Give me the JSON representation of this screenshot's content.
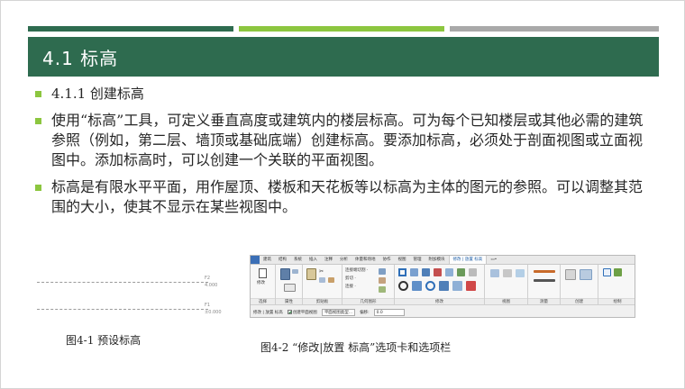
{
  "theme": {
    "accent_dark": "#2e6b4f",
    "accent_light": "#8cc63f",
    "accent_gray": "#a9a9a9",
    "title_band": "#2e6b4f",
    "bullet": "#8cc63f"
  },
  "slide": {
    "title": "4.1  标高",
    "bullets": [
      {
        "text": "4.1.1  创建标高"
      },
      {
        "text": "使用“标高”工具，可定义垂直高度或建筑内的楼层标高。可为每个已知楼层或其他必需的建筑参照（例如，第二层、墙顶或基础底端）创建标高。要添加标高，必须处于剖面视图或立面视图中。添加标高时，可以创建一个关联的平面视图。"
      },
      {
        "text": "标高是有限水平平面，用作屋顶、楼板和天花板等以标高为主体的图元的参照。可以调整其范围的大小，使其不显示在某些视图中。"
      }
    ]
  },
  "figure1": {
    "caption": "图4-1  预设标高",
    "levels": [
      {
        "name": "F2",
        "value": "4.000"
      },
      {
        "name": "F1",
        "value": "±0.000"
      }
    ]
  },
  "figure2": {
    "caption": "图4-2  “修改|放置 标高”选项卡和选项栏",
    "tabs": [
      "",
      "建筑",
      "结构",
      "系统",
      "插入",
      "注释",
      "分析",
      "体量和场地",
      "协作",
      "视图",
      "管理",
      "附加模块",
      "修改 | 放置 标高",
      "▭•"
    ],
    "active_tab": 12,
    "panels": [
      "选择",
      "属性",
      "剪贴板",
      "几何图形",
      "修改",
      "视图",
      "测量",
      "创建",
      "绘制"
    ],
    "panel_texts": {
      "modify": "修改",
      "select_dd": "选择 ▾",
      "prop_dd": "属性",
      "clip_cut": "✂",
      "clip_connect": "连接端切割 ·",
      "geo_cut": "剪切 ·",
      "geo_join": "连接 ·"
    },
    "options_bar": {
      "mode": "修改 | 放置 标高",
      "make_plan_view": "创建平面视图",
      "plan_view_types": "平面视图类型...",
      "offset_label": "偏移:",
      "offset_value": "0.0"
    }
  }
}
